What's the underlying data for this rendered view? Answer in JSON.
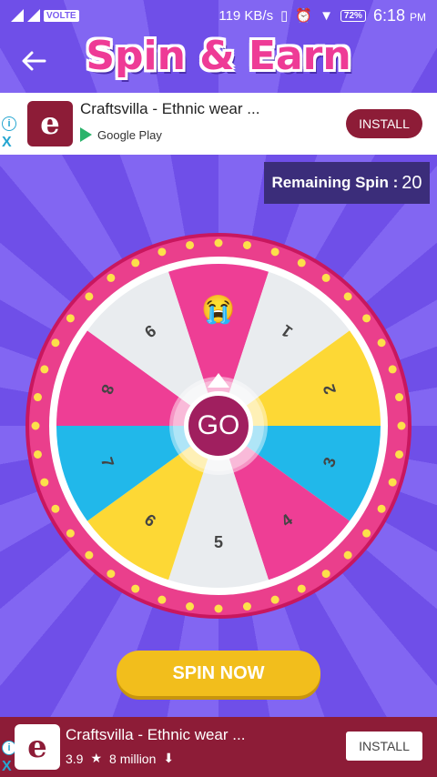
{
  "status_bar": {
    "network_label": "VOLTE",
    "speed": "119 KB/s",
    "battery": "72%",
    "time": "6:18",
    "ampm": "PM"
  },
  "header": {
    "back_icon": "arrow-left-icon",
    "title": "Spin & Earn"
  },
  "ad_top": {
    "logo_letter": "e",
    "title": "Craftsvilla - Ethnic wear ...",
    "store": "Google Play",
    "install_label": "INSTALL",
    "info_icon": "i",
    "close_icon": "X"
  },
  "remaining": {
    "label": "Remaining Spin :",
    "value": "20"
  },
  "wheel": {
    "segments": [
      {
        "label": "😭",
        "color": "#ee3e95"
      },
      {
        "label": "1",
        "color": "#e9ecef"
      },
      {
        "label": "2",
        "color": "#fdd835"
      },
      {
        "label": "3",
        "color": "#21b8ea"
      },
      {
        "label": "4",
        "color": "#ee3e95"
      },
      {
        "label": "5",
        "color": "#e9ecef"
      },
      {
        "label": "6",
        "color": "#fdd835"
      },
      {
        "label": "7",
        "color": "#21b8ea"
      },
      {
        "label": "8",
        "color": "#ee3e95"
      },
      {
        "label": "9",
        "color": "#e9ecef"
      }
    ],
    "go_label": "GO"
  },
  "spin_button": "SPIN NOW",
  "ad_bottom": {
    "logo_letter": "e",
    "title": "Craftsvilla - Ethnic wear ...",
    "rating": "3.9",
    "star": "★",
    "downloads": "8 million",
    "download_icon": "⬇",
    "install_label": "INSTALL",
    "info_icon": "i",
    "close_icon": "X"
  },
  "colors": {
    "background": "#7a5cf0",
    "title": "#ee3b96",
    "wheel_rim": "#ea3f8c",
    "accent_dark": "#8d1c37",
    "spin_button": "#f2be1c"
  }
}
